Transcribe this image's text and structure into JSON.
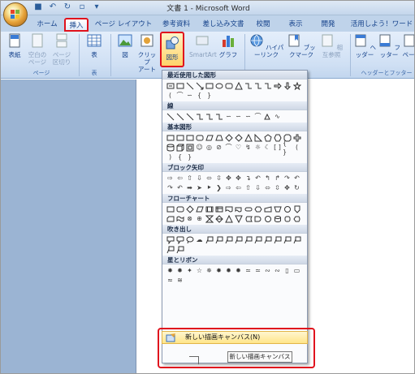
{
  "window_title": "文書 1 - Microsoft Word",
  "tabs": [
    "ホーム",
    "挿入",
    "ページ レイアウト",
    "参考資料",
    "差し込み文書",
    "校閲",
    "表示",
    "開発",
    "活用しよう！ワード"
  ],
  "ribbon": {
    "cover_page": "表紙",
    "blank_page": "空白の\nページ",
    "page_break": "ページ\n区切り",
    "group_pages": "ページ",
    "table": "表",
    "group_table": "表",
    "picture": "図",
    "clipart": "クリップ\nアート",
    "shapes": "図形",
    "smartart": "SmartArt",
    "chart": "グラフ",
    "hyperlink": "ハイパーリンク",
    "bookmark": "ブックマーク",
    "cross_ref": "相互参照",
    "header": "ヘッダー",
    "footer": "フッター",
    "page_num": "ペー",
    "group_header_footer": "ヘッダーとフッター"
  },
  "menu": {
    "sections": [
      "最近使用した図形",
      "線",
      "基本図形",
      "ブロック矢印",
      "フローチャート",
      "吹き出し",
      "星とリボン"
    ],
    "new_canvas_label": "新しい描画キャンバス(N)",
    "tooltip": "新しい描画キャンバス"
  },
  "colors": {
    "highlight": "#e0121d",
    "ribbon": "#d0e0f4",
    "menu_hover": "#ffe58a"
  }
}
